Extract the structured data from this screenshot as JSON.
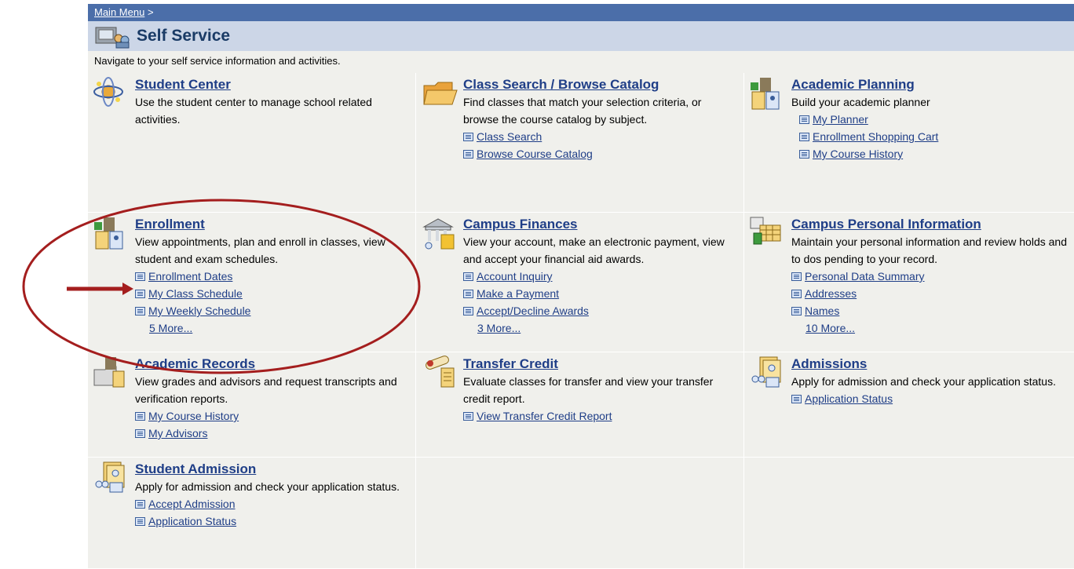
{
  "breadcrumb": {
    "link": "Main Menu",
    "separator": ">"
  },
  "page": {
    "title": "Self Service",
    "description": "Navigate to your self service information and activities."
  },
  "tiles": {
    "student_center": {
      "title": "Student Center",
      "desc": "Use the student center to manage school related activities.",
      "links": []
    },
    "class_search": {
      "title": "Class Search / Browse Catalog",
      "desc": "Find classes that match your selection criteria, or browse the course catalog by subject.",
      "links": [
        "Class Search",
        "Browse Course Catalog"
      ]
    },
    "academic_planning": {
      "title": "Academic Planning",
      "desc": "Build your academic planner",
      "links": [
        "My Planner",
        "Enrollment Shopping Cart",
        "My Course History"
      ]
    },
    "enrollment": {
      "title": "Enrollment",
      "desc": "View appointments, plan and enroll in classes, view student and exam schedules.",
      "links": [
        "Enrollment Dates",
        "My Class Schedule",
        "My Weekly Schedule"
      ],
      "more": "5 More..."
    },
    "campus_finances": {
      "title": "Campus Finances",
      "desc": "View your account, make an electronic payment, view and accept your financial aid awards.",
      "links": [
        "Account Inquiry",
        "Make a Payment",
        "Accept/Decline Awards"
      ],
      "more": "3 More..."
    },
    "campus_personal": {
      "title": "Campus Personal Information",
      "desc": "Maintain your personal information and review holds and to dos pending to your record.",
      "links": [
        "Personal Data Summary",
        "Addresses",
        "Names"
      ],
      "more": "10 More..."
    },
    "academic_records": {
      "title": "Academic Records",
      "desc": "View grades and advisors and request transcripts and verification reports.",
      "links": [
        "My Course History",
        "My Advisors"
      ]
    },
    "transfer_credit": {
      "title": "Transfer Credit",
      "desc": "Evaluate classes for transfer and view your transfer credit report.",
      "links": [
        "View Transfer Credit Report"
      ]
    },
    "admissions": {
      "title": "Admissions",
      "desc": "Apply for admission and check your application status.",
      "links": [
        "Application Status"
      ]
    },
    "student_admission": {
      "title": "Student Admission",
      "desc": "Apply for admission and check your application status.",
      "links": [
        "Accept Admission",
        "Application Status"
      ]
    }
  },
  "colors": {
    "annotation": "#a41e1e",
    "header": "#4b6ea9",
    "link": "#1f3e87"
  }
}
